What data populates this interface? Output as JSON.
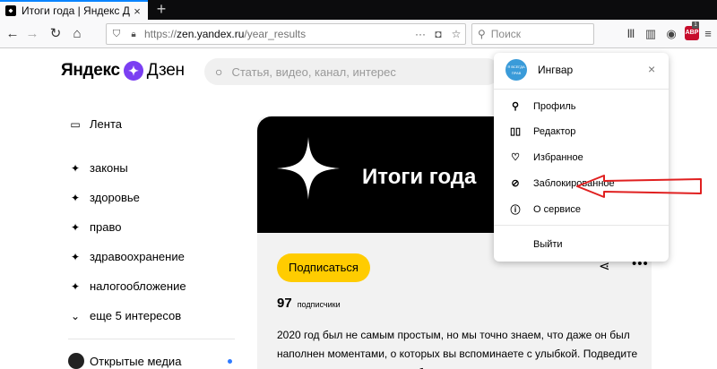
{
  "browser": {
    "tab_title": "Итоги года | Яндекс Дзен",
    "tab_close": "×",
    "new_tab": "+",
    "url_prefix": "https://",
    "url_host": "zen.yandex.ru",
    "url_path": "/year_results",
    "search_placeholder": "Поиск",
    "abp_label": "ABP",
    "abp_count": "1"
  },
  "header": {
    "logo_left": "Яндекс",
    "logo_right": "Дзен",
    "search_placeholder": "Статья, видео, канал, интерес"
  },
  "sidebar": {
    "feed": "Лента",
    "interests": [
      "законы",
      "здоровье",
      "право",
      "здравоохранение",
      "налогообложение"
    ],
    "more": "еще 5 интересов",
    "media": "Открытые медиа"
  },
  "card": {
    "title": "Итоги года",
    "subscribe": "Подписаться",
    "subscribers_count": "97",
    "subscribers_label": "подписчики",
    "description": "2020 год был не самым простым, но мы точно знаем, что даже он был наполнен моментами, о которых вы вспоминаете с улыбкой. Подведите итоги года о самых ярких событиях, которые произошли с вами и вашими"
  },
  "popup": {
    "avatar_text": "Я ВСЕГДА ПРАВ",
    "user": "Ингвар",
    "close": "×",
    "items": [
      "Профиль",
      "Редактор",
      "Избранное",
      "Заблокированное",
      "О сервисе"
    ],
    "logout": "Выйти"
  },
  "colors": {
    "accent_subscribe": "#ffcc00",
    "annotation_arrow": "#e02020",
    "logo_star": "#7b3ff2"
  }
}
